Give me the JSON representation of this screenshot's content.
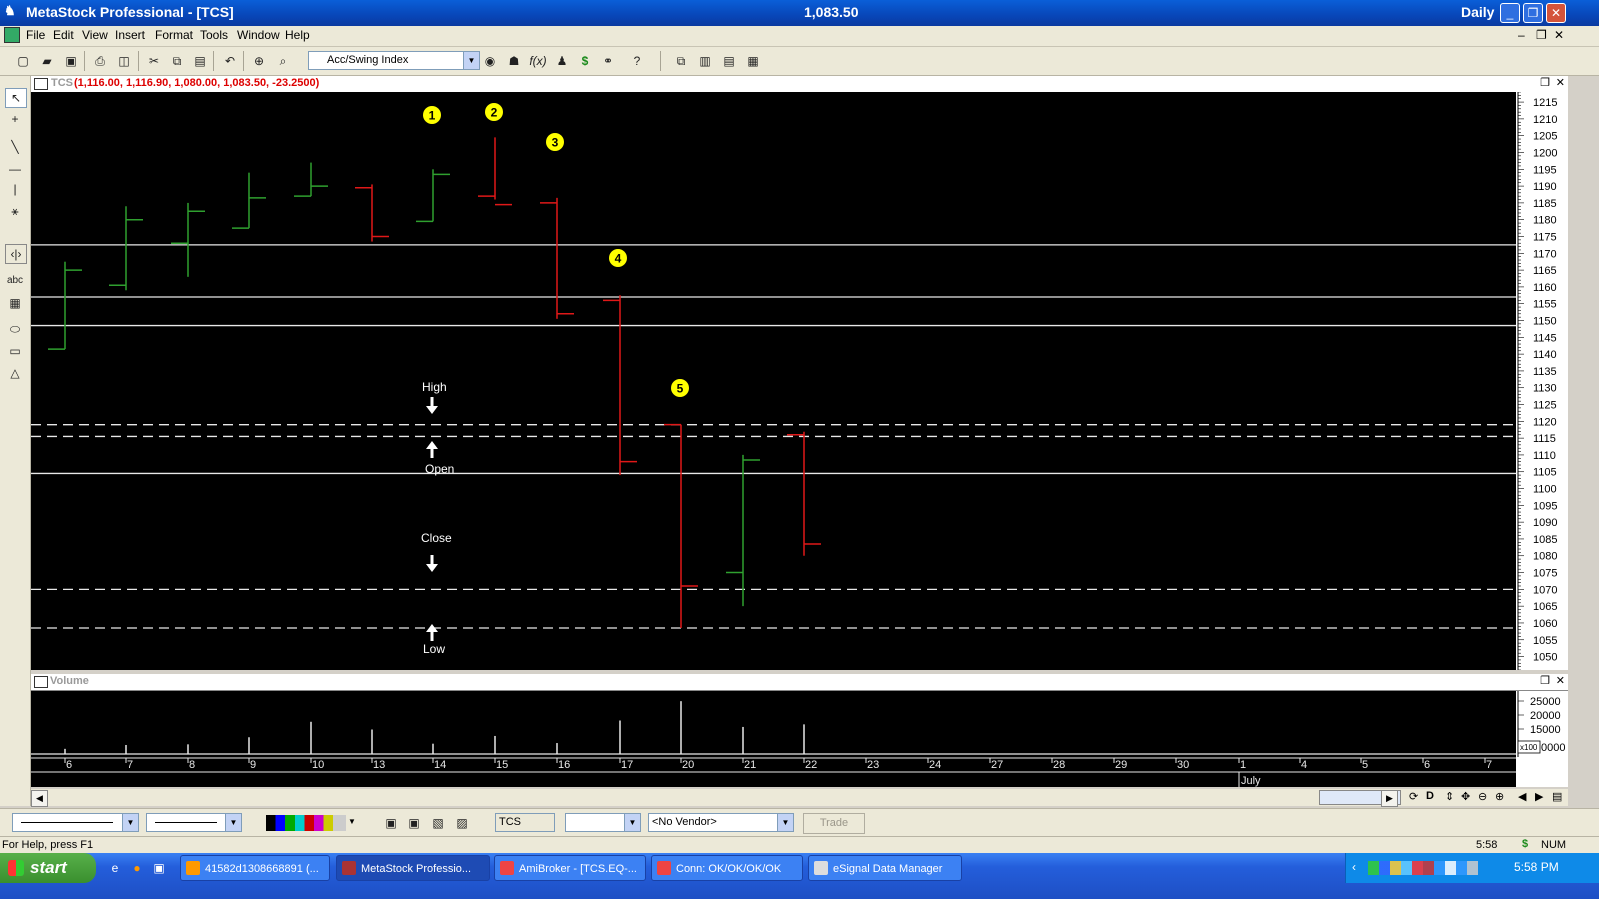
{
  "window": {
    "title": "MetaStock Professional - [TCS]",
    "last_price": "1,083.50",
    "period": "Daily"
  },
  "menu": [
    "File",
    "Edit",
    "View",
    "Insert",
    "Format",
    "Tools",
    "Window",
    "Help"
  ],
  "toolbar": {
    "indicator_select": "Acc/Swing Index"
  },
  "chart_header": {
    "symbol": "TCS",
    "ohlc": "(1,116.00, 1,116.90, 1,080.00, 1,083.50, -23.2500)"
  },
  "volume_header": {
    "label": "Volume"
  },
  "annotations": {
    "markers": [
      "1",
      "2",
      "3",
      "4",
      "5"
    ],
    "high_label": "High",
    "open_label": "Open",
    "close_label": "Close",
    "low_label": "Low"
  },
  "colors": {
    "up_bar": "#2fa02f",
    "down_bar": "#e01818",
    "marker": "#ffff00",
    "background": "#000000"
  },
  "chart_data": {
    "type": "ohlc",
    "dates": [
      "6",
      "7",
      "8",
      "9",
      "10",
      "13",
      "14",
      "15",
      "16",
      "17",
      "20",
      "21",
      "22"
    ],
    "open": [
      1141.5,
      1160.5,
      1173.0,
      1177.5,
      1187.0,
      1189.5,
      1179.5,
      1187.0,
      1185.0,
      1156.0,
      1119.0,
      1075.0,
      1116.0
    ],
    "high": [
      1167.5,
      1184.0,
      1185.0,
      1194.0,
      1197.0,
      1190.5,
      1195.0,
      1204.5,
      1186.5,
      1157.5,
      1119.0,
      1110.0,
      1116.9
    ],
    "low": [
      1141.5,
      1159.0,
      1163.0,
      1177.5,
      1187.0,
      1173.5,
      1179.5,
      1186.0,
      1150.5,
      1104.0,
      1058.5,
      1065.0,
      1080.0
    ],
    "close": [
      1165.0,
      1180.0,
      1182.5,
      1186.5,
      1190.0,
      1175.0,
      1193.5,
      1184.5,
      1152.0,
      1108.0,
      1071.0,
      1108.5,
      1083.5
    ],
    "ylim": [
      1046,
      1218
    ],
    "yticks": [
      1215,
      1210,
      1205,
      1200,
      1195,
      1190,
      1185,
      1180,
      1175,
      1170,
      1165,
      1160,
      1155,
      1150,
      1145,
      1140,
      1135,
      1130,
      1125,
      1120,
      1115,
      1110,
      1105,
      1100,
      1095,
      1090,
      1085,
      1080,
      1075,
      1070,
      1065,
      1060,
      1055,
      1050
    ],
    "hlines_solid": [
      1172.5,
      1157.0,
      1148.5,
      1104.5
    ],
    "hlines_dashed": [
      1119.0,
      1115.5,
      1070.0,
      1058.5
    ],
    "volume": [
      4000,
      7000,
      7500,
      13000,
      25000,
      19000,
      8000,
      14000,
      8500,
      26000,
      41000,
      21000,
      23000
    ],
    "volume_ticks": [
      "25000",
      "20000",
      "15000",
      "x100",
      "0000"
    ],
    "x_ticks": [
      "6",
      "7",
      "8",
      "9",
      "10",
      "13",
      "14",
      "15",
      "16",
      "17",
      "20",
      "21",
      "22",
      "23",
      "24",
      "27",
      "28",
      "29",
      "30",
      "1",
      "4",
      "5",
      "6",
      "7"
    ],
    "month_label": "July"
  },
  "bottom": {
    "symbol_field": "TCS",
    "vendor": "<No Vendor>",
    "trade_button": "Trade"
  },
  "status": {
    "help": "For Help, press F1",
    "time": "5:58",
    "num": "NUM"
  },
  "taskbar": {
    "start": "start",
    "tasks": [
      "41582d1308668891 (...",
      "MetaStock Professio...",
      "AmiBroker - [TCS.EQ-...",
      "Conn: OK/OK/OK/OK",
      "eSignal Data Manager"
    ],
    "clock": "5:58 PM"
  }
}
